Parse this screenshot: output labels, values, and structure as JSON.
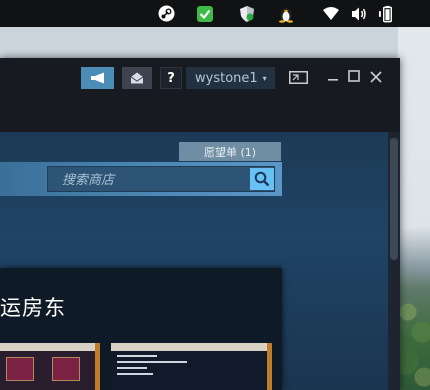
{
  "system_tray": {
    "icons": [
      "steam-icon",
      "checkmark-shield-icon",
      "security-shield-icon",
      "linux-penguin-icon",
      "wifi-icon",
      "volume-icon",
      "battery-icon"
    ]
  },
  "titlebar": {
    "help_label": "?",
    "account_name": "wystone1",
    "account_caret": "▾"
  },
  "store": {
    "wishlist_label": "愿望单 (1)",
    "search_placeholder": "搜索商店",
    "promo_title": "运房东"
  },
  "colors": {
    "window_bg": "#171a21",
    "accent": "#67c1f5",
    "announce_button": "#4b8db5",
    "store_nav": "#4b86b3"
  }
}
